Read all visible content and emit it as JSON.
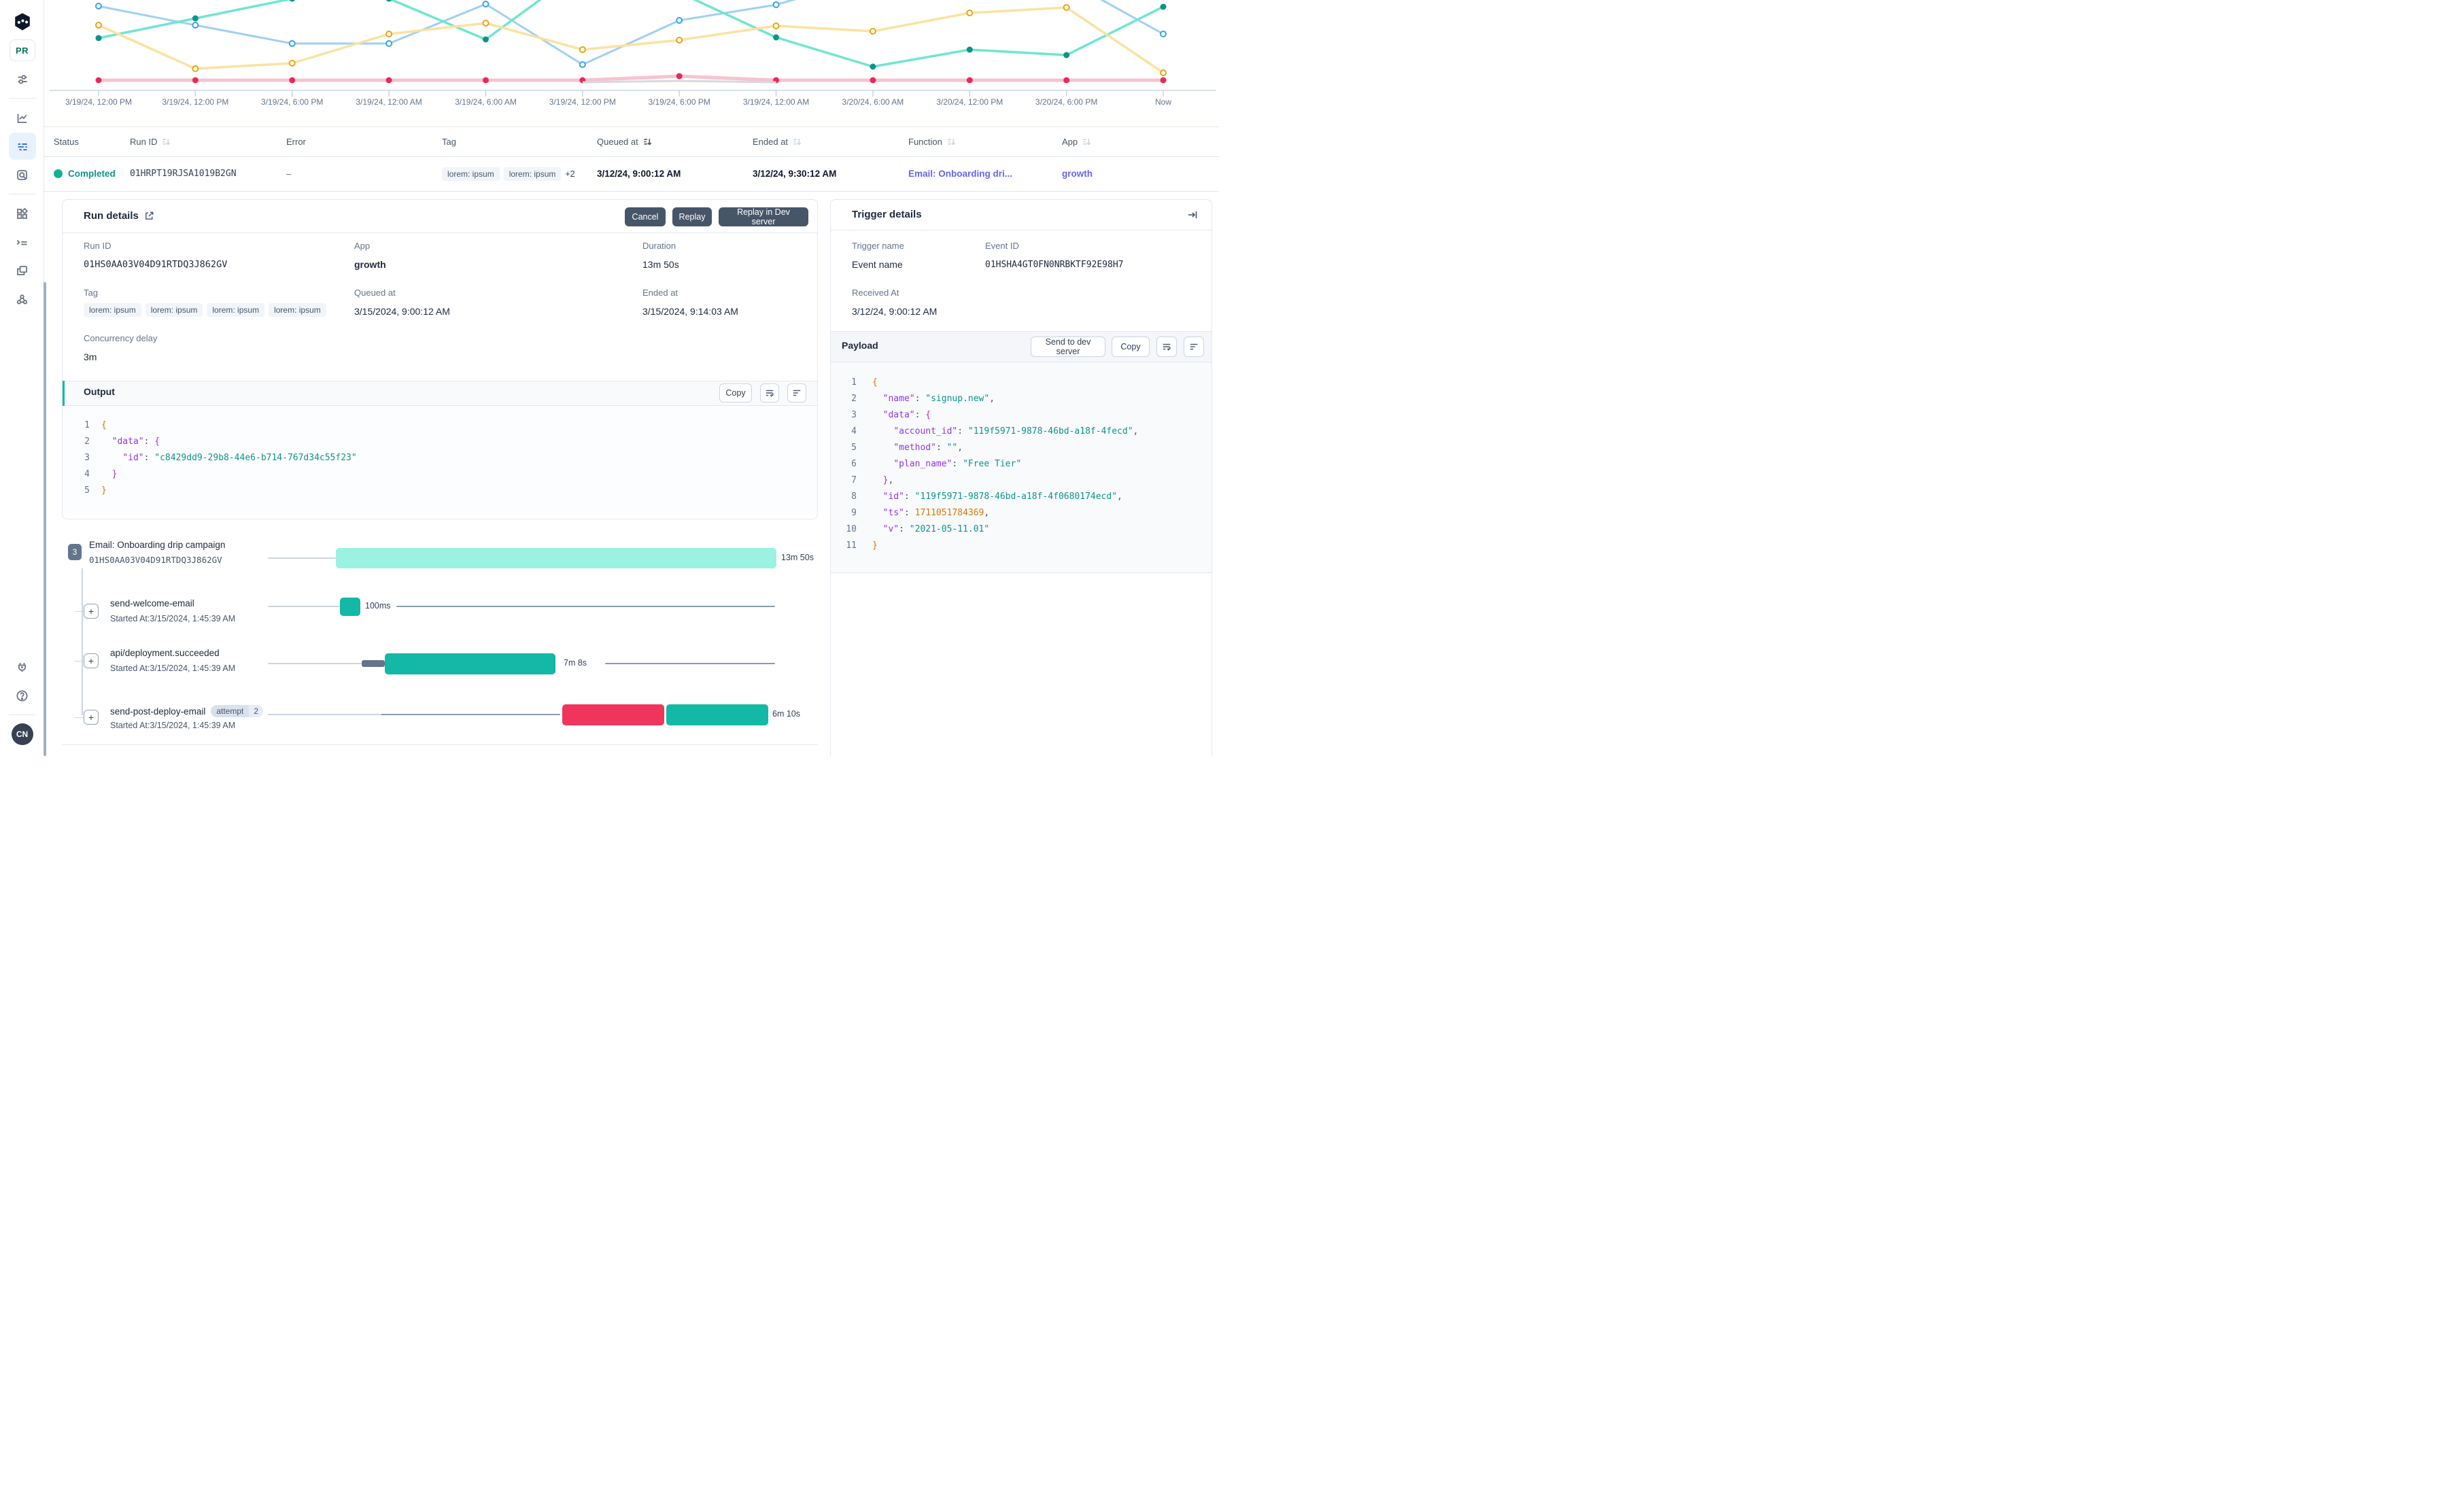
{
  "sidebar": {
    "logo": "inngest-logo",
    "pr_label": "PR",
    "avatar_initials": "CN",
    "top_icons": [
      {
        "name": "sliders-icon",
        "active": false
      },
      {
        "name": "divider"
      },
      {
        "name": "metrics-chart-icon",
        "active": false
      },
      {
        "name": "runs-list-icon",
        "active": true
      },
      {
        "name": "doc-search-icon",
        "active": false
      },
      {
        "name": "divider"
      },
      {
        "name": "apps-icon",
        "active": false
      },
      {
        "name": "terminal-icon",
        "active": false
      },
      {
        "name": "windows-icon",
        "active": false
      },
      {
        "name": "webhook-icon",
        "active": false
      }
    ],
    "bottom_icons": [
      {
        "name": "plug-icon"
      },
      {
        "name": "help-icon"
      }
    ]
  },
  "chart_data": {
    "type": "line",
    "title": "",
    "xlabel": "",
    "ylabel": "",
    "grid": false,
    "legend_position": "none",
    "x_tick_labels": [
      "3/19/24, 12:00 PM",
      "3/19/24, 12:00 PM",
      "3/19/24, 6:00 PM",
      "3/19/24, 12:00 AM",
      "3/19/24, 6:00 AM",
      "3/19/24, 12:00 PM",
      "3/19/24, 6:00 PM",
      "3/19/24, 12:00 AM",
      "3/20/24, 6:00 AM",
      "3/20/24, 12:00 PM",
      "3/20/24, 6:00 PM",
      "Now"
    ],
    "series": [
      {
        "name": "sky-series",
        "line": "#9fd0f4",
        "dot": "#38a2e8",
        "open": true,
        "width": 3,
        "y": [
          9,
          37,
          64,
          64,
          6,
          95,
          30,
          7,
          -34,
          -51,
          -29,
          50
        ]
      },
      {
        "name": "mint-series",
        "line": "#6fe6d0",
        "dot": "#0d9488",
        "open": false,
        "width": 3.5,
        "y": [
          56,
          27,
          -2,
          -2,
          58,
          -46,
          -11,
          55,
          98,
          73,
          81,
          10
        ]
      },
      {
        "name": "amber-series",
        "line": "#fbe2a0",
        "dot": "#eda310",
        "open": true,
        "width": 3.5,
        "y": [
          37,
          101,
          93,
          50,
          34,
          73,
          59,
          38,
          46,
          19,
          11,
          107
        ]
      },
      {
        "name": "rose-series",
        "line": "#f7c3ce",
        "dot": "#e8295a",
        "open": false,
        "width": 5,
        "y": [
          118,
          118,
          118,
          118,
          118,
          118,
          112,
          118,
          118,
          118,
          118,
          118
        ]
      },
      {
        "name": "gray-series",
        "line": "#d6d9de",
        "dot": null,
        "open": false,
        "width": 3,
        "y": [
          null,
          null,
          null,
          null,
          null,
          121,
          119,
          121,
          null,
          null,
          null,
          null
        ]
      }
    ],
    "axis_color": "#cbd5e1"
  },
  "table": {
    "headers": [
      {
        "label": "Status",
        "sort": null
      },
      {
        "label": "Run ID",
        "sort": "inactive"
      },
      {
        "label": "Error",
        "sort": null
      },
      {
        "label": "Tag",
        "sort": null
      },
      {
        "label": "Queued at",
        "sort": "active"
      },
      {
        "label": "Ended at",
        "sort": "inactive"
      },
      {
        "label": "Function",
        "sort": "inactive"
      },
      {
        "label": "App",
        "sort": "inactive"
      }
    ],
    "row": {
      "status": "Completed",
      "status_color": "#14b09a",
      "run_id": "01HRPT19RJSA1019B2GN",
      "error": "–",
      "tags": [
        "lorem: ipsum",
        "lorem: ipsum"
      ],
      "tags_more": "+2",
      "queued_at": "3/12/24, 9:00:12 AM",
      "ended_at": "3/12/24, 9:30:12 AM",
      "function": "Email: Onboarding dri...",
      "app": "growth"
    }
  },
  "run_details": {
    "title": "Run details",
    "buttons": {
      "cancel": "Cancel",
      "replay": "Replay",
      "replay_dev": "Replay in Dev server"
    },
    "run_id_label": "Run ID",
    "run_id": "01HS0AA03V04D91RTDQ3J862GV",
    "app_label": "App",
    "app": "growth",
    "duration_label": "Duration",
    "duration": "13m 50s",
    "tag_label": "Tag",
    "tags": [
      "lorem: ipsum",
      "lorem: ipsum",
      "lorem: ipsum",
      "lorem: ipsum"
    ],
    "queued_label": "Queued at",
    "queued_at": "3/15/2024, 9:00:12 AM",
    "ended_label": "Ended at",
    "ended_at": "3/15/2024, 9:14:03 AM",
    "concurrency_label": "Concurrency delay",
    "concurrency": "3m"
  },
  "output": {
    "title": "Output",
    "copy_label": "Copy",
    "lines": [
      {
        "n": "1",
        "t": [
          [
            "o",
            "{"
          ]
        ]
      },
      {
        "n": "2",
        "t": [
          [
            "p",
            "  "
          ],
          [
            "k",
            "\"data\""
          ],
          [
            "p",
            ": "
          ],
          [
            "m",
            "{"
          ]
        ]
      },
      {
        "n": "3",
        "t": [
          [
            "p",
            "    "
          ],
          [
            "k",
            "\"id\""
          ],
          [
            "p",
            ": "
          ],
          [
            "s",
            "\"c8429dd9-29b8-44e6-b714-767d34c55f23\""
          ]
        ]
      },
      {
        "n": "4",
        "t": [
          [
            "p",
            "  "
          ],
          [
            "m",
            "}"
          ]
        ]
      },
      {
        "n": "5",
        "t": [
          [
            "o",
            "}"
          ]
        ]
      }
    ]
  },
  "trigger": {
    "title": "Trigger details",
    "trigger_name_label": "Trigger name",
    "event_id_label": "Event ID",
    "trigger_name": "Event name",
    "event_id": "01HSHA4GT0FN0NRBKTF92E98H7",
    "received_label": "Received At",
    "received_at": "3/12/24, 9:00:12 AM",
    "payload_title": "Payload",
    "send_dev_label": "Send to dev server",
    "copy_label": "Copy",
    "payload_lines": [
      {
        "n": "1",
        "t": [
          [
            "o",
            "{"
          ]
        ]
      },
      {
        "n": "2",
        "t": [
          [
            "p",
            "  "
          ],
          [
            "k",
            "\"name\""
          ],
          [
            "p",
            ": "
          ],
          [
            "s",
            "\"signup.new\""
          ],
          [
            "p",
            ","
          ]
        ]
      },
      {
        "n": "3",
        "t": [
          [
            "p",
            "  "
          ],
          [
            "k",
            "\"data\""
          ],
          [
            "p",
            ": "
          ],
          [
            "m",
            "{"
          ]
        ]
      },
      {
        "n": "4",
        "t": [
          [
            "p",
            "    "
          ],
          [
            "k",
            "\"account_id\""
          ],
          [
            "p",
            ": "
          ],
          [
            "s",
            "\"119f5971-9878-46bd-a18f-4fecd\""
          ],
          [
            "p",
            ","
          ]
        ]
      },
      {
        "n": "5",
        "t": [
          [
            "p",
            "    "
          ],
          [
            "k",
            "\"method\""
          ],
          [
            "p",
            ": "
          ],
          [
            "s",
            "\"\""
          ],
          [
            "p",
            ","
          ]
        ]
      },
      {
        "n": "6",
        "t": [
          [
            "p",
            "    "
          ],
          [
            "k",
            "\"plan_name\""
          ],
          [
            "p",
            ": "
          ],
          [
            "s",
            "\"Free Tier\""
          ]
        ]
      },
      {
        "n": "7",
        "t": [
          [
            "p",
            "  "
          ],
          [
            "m",
            "}"
          ],
          [
            "p",
            ","
          ]
        ]
      },
      {
        "n": "8",
        "t": [
          [
            "p",
            "  "
          ],
          [
            "k",
            "\"id\""
          ],
          [
            "p",
            ": "
          ],
          [
            "s",
            "\"119f5971-9878-46bd-a18f-4f0680174ecd\""
          ],
          [
            "p",
            ","
          ]
        ]
      },
      {
        "n": "9",
        "t": [
          [
            "p",
            "  "
          ],
          [
            "k",
            "\"ts\""
          ],
          [
            "p",
            ": "
          ],
          [
            "n",
            "1711051784369"
          ],
          [
            "p",
            ","
          ]
        ]
      },
      {
        "n": "10",
        "t": [
          [
            "p",
            "  "
          ],
          [
            "k",
            "\"v\""
          ],
          [
            "p",
            ": "
          ],
          [
            "s",
            "\"2021-05-11.01\""
          ]
        ]
      },
      {
        "n": "11",
        "t": [
          [
            "o",
            "}"
          ]
        ]
      }
    ]
  },
  "timeline": {
    "colors": {
      "mint": "#9cf2e0",
      "teal": "#14b8a6",
      "red": "#f0355c",
      "slate": "#64748b",
      "line_light": "#cbd5e1",
      "line_dark": "#8b9bb0"
    },
    "rows": [
      {
        "kind": "root",
        "badge": "3",
        "name": "Email: Onboarding drip campaign",
        "run_id": "01HS0AA03V04D91RTDQ3J862GV",
        "duration": "13m 50s",
        "ty": 794,
        "cy": 821,
        "label_x": 1149,
        "bars": [
          {
            "t": "line_light",
            "x1": 394,
            "x2": 494
          },
          {
            "t": "mint",
            "x1": 494,
            "x2": 1142,
            "h": 30
          }
        ]
      },
      {
        "kind": "step",
        "name": "send-welcome-email",
        "started": "Started At:3/15/2024, 1:45:39 AM",
        "duration": "100ms",
        "ty": 880,
        "cy": 892,
        "plus_y": 888,
        "label_x": 537,
        "bars": [
          {
            "t": "line_light",
            "x1": 394,
            "x2": 500
          },
          {
            "t": "teal",
            "x1": 500,
            "x2": 530,
            "h": 27
          },
          {
            "t": "line_dark",
            "x1": 583,
            "x2": 1140
          }
        ]
      },
      {
        "kind": "step",
        "name": "api/deployment.succeeded",
        "started": "Started At:3/15/2024, 1:45:39 AM",
        "duration": "7m 8s",
        "ty": 953,
        "cy": 976,
        "plus_y": 961,
        "label_x": 829,
        "bars": [
          {
            "t": "line_light",
            "x1": 394,
            "x2": 532
          },
          {
            "t": "slate",
            "x1": 532,
            "x2": 566,
            "h": 10
          },
          {
            "t": "teal",
            "x1": 566,
            "x2": 817,
            "h": 31
          },
          {
            "t": "line_dark",
            "x1": 890,
            "x2": 1140
          }
        ]
      },
      {
        "kind": "step",
        "name": "send-post-deploy-email",
        "attempt_label": "attempt",
        "attempt_count": "2",
        "started": "Started At:3/15/2024, 1:45:39 AM",
        "duration": "6m 10s",
        "ty": 1037,
        "cy": 1051,
        "plus_y": 1044,
        "label_x": 1136,
        "bars": [
          {
            "t": "line_light",
            "x1": 394,
            "x2": 560
          },
          {
            "t": "line_dark",
            "x1": 560,
            "x2": 824
          },
          {
            "t": "red",
            "x1": 827,
            "x2": 977,
            "h": 31
          },
          {
            "t": "teal",
            "x1": 980,
            "x2": 1130,
            "h": 31
          }
        ]
      }
    ]
  }
}
